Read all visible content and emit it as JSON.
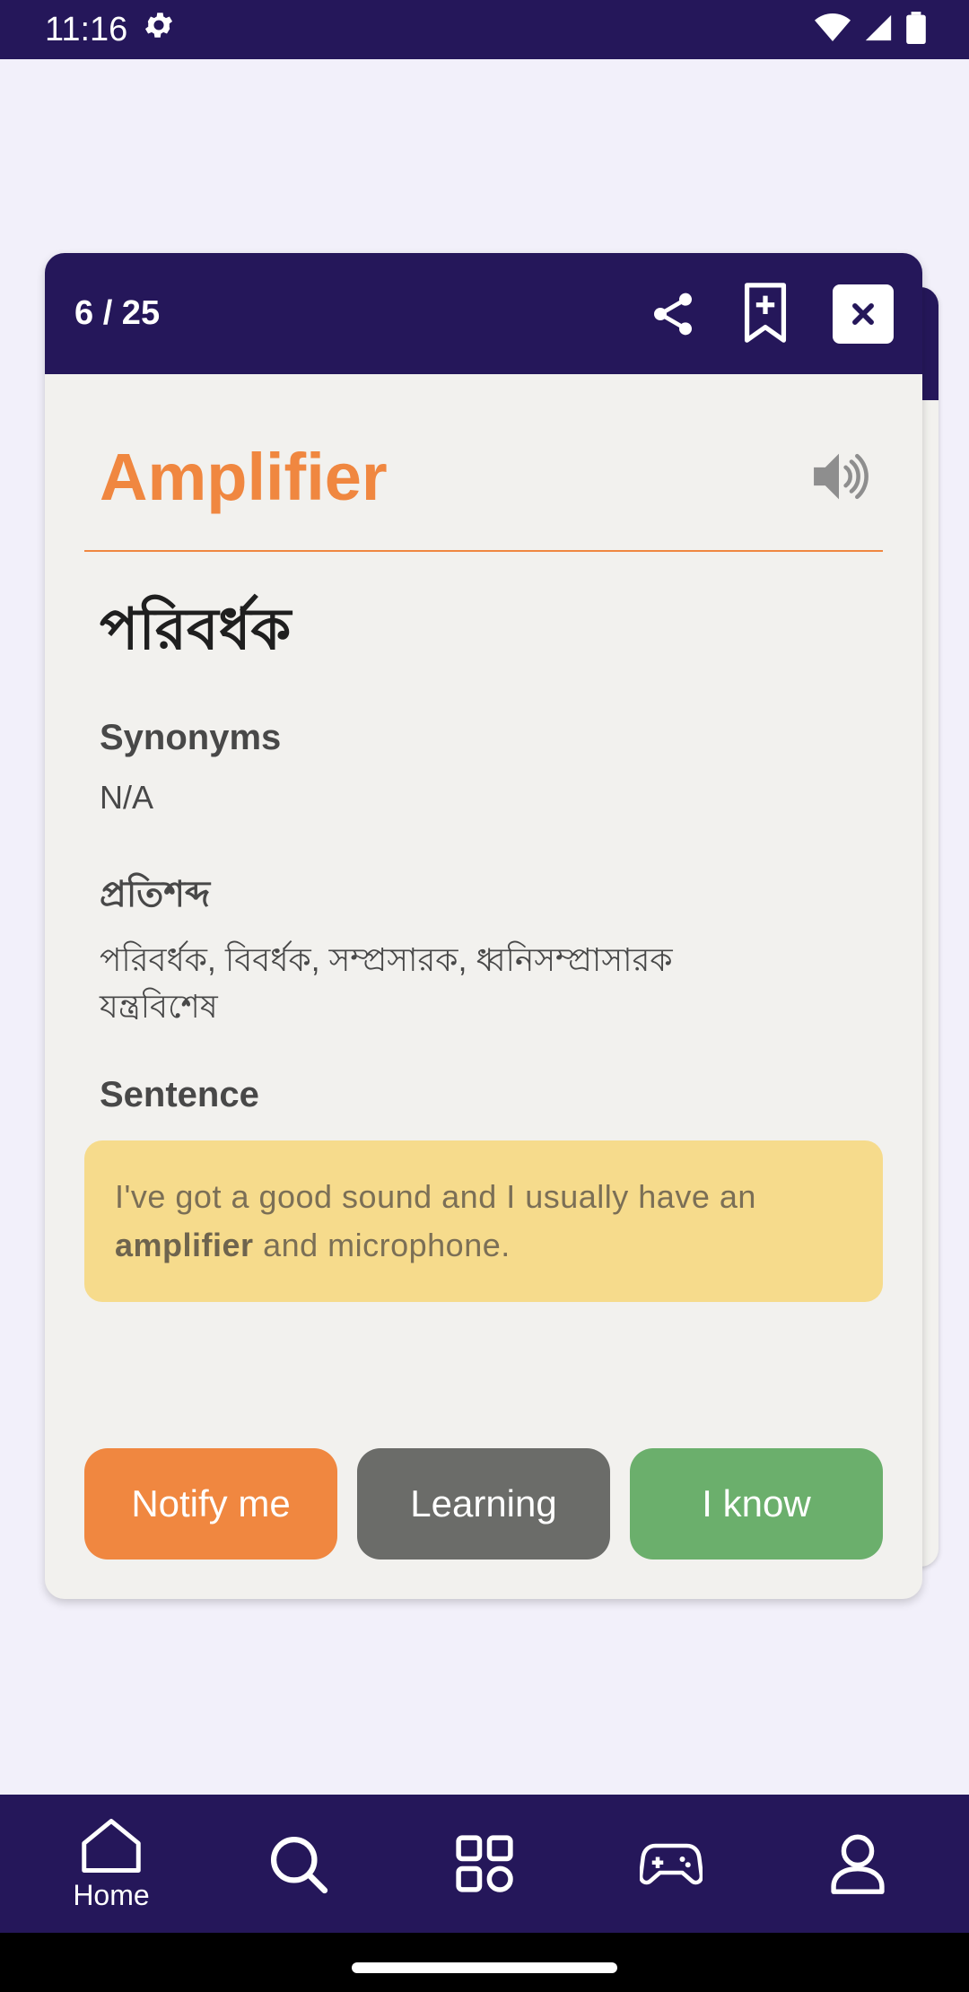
{
  "status": {
    "time": "11:16",
    "settings_icon": "gear-icon",
    "icons": [
      "wifi-icon",
      "signal-icon",
      "battery-icon"
    ]
  },
  "card": {
    "counter": "6 / 25",
    "word": "Amplifier",
    "translation": "পরিবর্ধক",
    "synonyms_title": "Synonyms",
    "synonyms_value": "N/A",
    "prati_title": "প্রতিশব্দ",
    "prati_value": "পরিবর্ধক, বিবর্ধক, সম্প্রসারক, ধ্বনিসম্প্রাসারক যন্ত্রবিশেষ",
    "sentence_title": "Sentence",
    "sentence_before": "I've got a good sound and I usually have an",
    "sentence_bold": "amplifier",
    "sentence_after": "and microphone."
  },
  "actions": {
    "notify": "Notify me",
    "learning": "Learning",
    "know": "I know"
  },
  "nav": {
    "home_label": "Home"
  },
  "colors": {
    "primary": "#25175a",
    "accent": "#f08740",
    "learning": "#6b6c69",
    "know": "#6baf6c",
    "sentence_bg": "#f6db8c"
  }
}
